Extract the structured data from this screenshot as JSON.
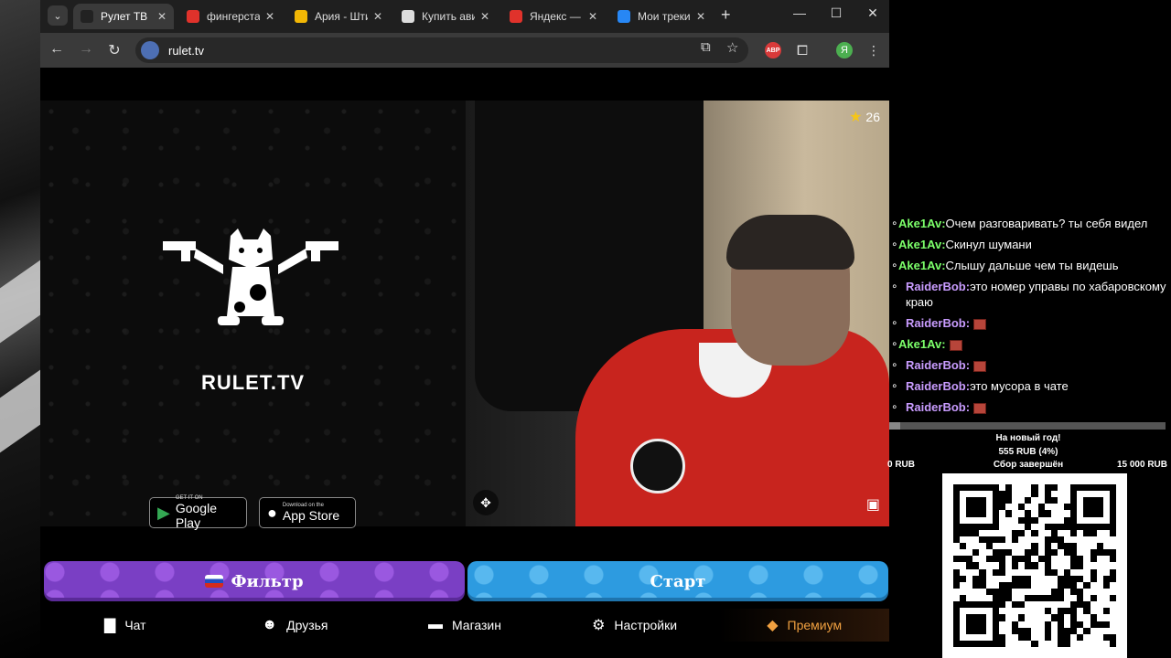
{
  "browser": {
    "tabs": [
      {
        "label": "Рулет ТВ",
        "favicon_color": "#222222",
        "active": true
      },
      {
        "label": "фингерстайл",
        "favicon_color": "#e0322b",
        "active": false
      },
      {
        "label": "Ария - Штиль",
        "favicon_color": "#f2b705",
        "active": false
      },
      {
        "label": "Купить авиабилеты",
        "favicon_color": "#dddddd",
        "active": false
      },
      {
        "label": "Яндекс — быстрый",
        "favicon_color": "#e0322b",
        "active": false
      },
      {
        "label": "Мои треки",
        "favicon_color": "#2787f5",
        "active": false
      }
    ],
    "new_tab": "+",
    "minimize": "—",
    "maximize": "☐",
    "close": "✕",
    "url": "rulet.tv",
    "profile_letter": "Я",
    "abp_label": "ABP"
  },
  "promo": {
    "logo_text": "RULET.TV",
    "google_play": {
      "small": "GET IT ON",
      "big": "Google Play"
    },
    "app_store": {
      "small": "Download on the",
      "big": "App Store"
    }
  },
  "video": {
    "star_count": "26"
  },
  "buttons": {
    "filter": "Фильтр",
    "start": "Старт"
  },
  "nav": {
    "chat": "Чат",
    "friends": "Друзья",
    "shop": "Магазин",
    "settings": "Настройки",
    "premium": "Премиум"
  },
  "chat": {
    "messages": [
      {
        "nick": "Ake1Av:",
        "text": "Очем разговаривать? ты себя видел",
        "nick_color": "green"
      },
      {
        "nick": "Ake1Av:",
        "text": "Скинул шумани",
        "nick_color": "green"
      },
      {
        "nick": "Ake1Av:",
        "text": "Слышу дальше чем ты видешь",
        "nick_color": "green"
      },
      {
        "nick": "RaiderBob:",
        "text": "это номер управы по хабаровскому краю",
        "nick_color": "purple"
      },
      {
        "nick": "RaiderBob:",
        "text": "",
        "nick_color": "purple",
        "emote": true
      },
      {
        "nick": "Ake1Av:",
        "text": "",
        "nick_color": "green",
        "emote": true
      },
      {
        "nick": "RaiderBob:",
        "text": "",
        "nick_color": "purple",
        "emote": true
      },
      {
        "nick": "RaiderBob:",
        "text": "это мусора в чате",
        "nick_color": "purple"
      },
      {
        "nick": "RaiderBob:",
        "text": "",
        "nick_color": "purple",
        "emote": true
      }
    ]
  },
  "donation": {
    "title": "На новый год!",
    "progress": "555 RUB (4%)",
    "progress_fraction": 0.04,
    "min": "0 RUB",
    "status": "Сбор завершён",
    "max": "15 000 RUB"
  }
}
